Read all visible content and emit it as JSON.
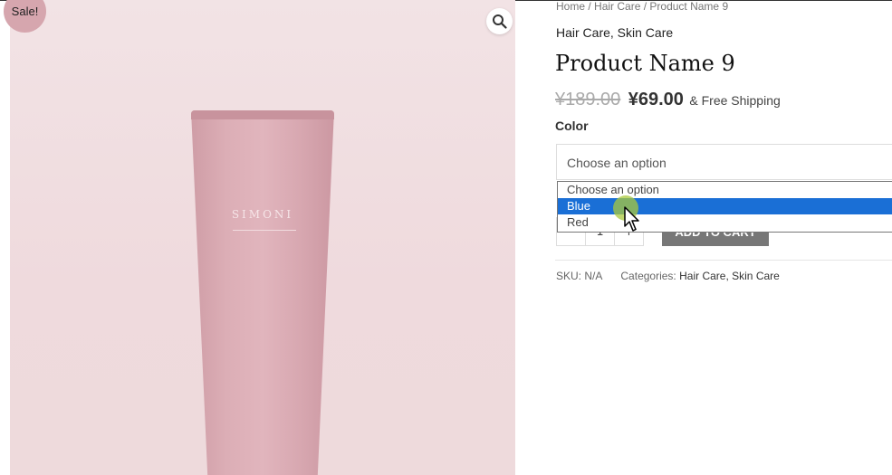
{
  "badge": {
    "sale": "Sale!"
  },
  "gallery": {
    "brand": "SIMONI",
    "zoom_icon": "magnifier-icon"
  },
  "breadcrumb": {
    "home": "Home",
    "sep": " / ",
    "category": "Hair Care",
    "current": "Product Name 9"
  },
  "product": {
    "categories_top": "Hair Care, Skin Care",
    "title": "Product Name 9",
    "price_old": "¥189.00",
    "price_new": "¥69.00",
    "shipping": "& Free Shipping",
    "color_label": "Color",
    "select_value": "Choose an option",
    "options": [
      "Choose an option",
      "Blue",
      "Red"
    ],
    "selected_option": "Blue",
    "qty_minus": "-",
    "qty_value": "1",
    "qty_plus": "+",
    "add_to_cart": "ADD TO CART",
    "sku_label": "SKU:",
    "sku_value": "N/A",
    "categories_label": "Categories:",
    "category_1": "Hair Care",
    "category_sep": ", ",
    "category_2": "Skin Care"
  },
  "colors": {
    "selected_option_bg": "#1a6fd6",
    "button_bg": "#777777",
    "badge_bg": "#d6a6ae"
  }
}
